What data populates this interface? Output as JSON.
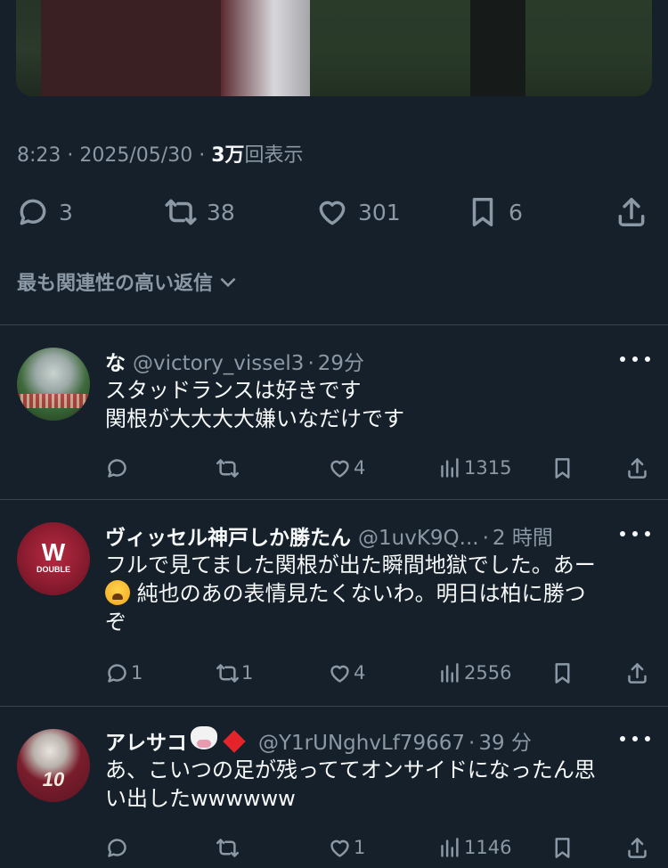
{
  "tweet": {
    "meta": {
      "time": "8:23",
      "sep": " · ",
      "date": "2025/05/30",
      "sep2": " · ",
      "views": "3万",
      "views_suffix": "回表示"
    },
    "actions": {
      "replies": "3",
      "retweets": "38",
      "likes": "301",
      "bookmarks": "6"
    }
  },
  "sort": {
    "label": "最も関連性の高い返信"
  },
  "replies": [
    {
      "name": "な",
      "handle": "@victory_vissel3",
      "time": "29分",
      "lines": [
        "スタッドランスは好きです",
        "関根が大大大大嫌いなだけです"
      ],
      "reply_count": "",
      "retweet_count": "",
      "like_count": "4",
      "views": "1315"
    },
    {
      "name": "ヴィッセル神戸しか勝たん",
      "handle": "@1uvK9Q...",
      "time": "2 時間",
      "avatar_text": "W",
      "avatar_sub": "DOUBLE",
      "line1": "フルで見てました関根が出た瞬間地獄でした。あー",
      "line2": "純也のあの表情見たくないわ。明日は柏に勝つ",
      "line3": "ぞ",
      "reply_count": "1",
      "retweet_count": "1",
      "like_count": "4",
      "views": "2556"
    },
    {
      "name": "アレサコ",
      "handle": "@Y1rUNghvLf79667",
      "time": "39 分",
      "avatar_text": "10",
      "lines": [
        "あ、こいつの足が残っててオンサイドになったん思",
        "い出したwwwwww"
      ],
      "reply_count": "",
      "retweet_count": "",
      "like_count": "1",
      "views": "1146"
    }
  ]
}
